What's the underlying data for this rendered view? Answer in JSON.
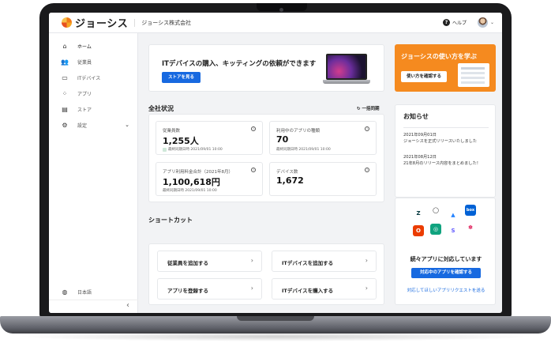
{
  "header": {
    "logo_text": "ジョーシス",
    "company": "ジョーシス株式会社",
    "help_label": "ヘルプ"
  },
  "sidebar": {
    "items": [
      {
        "label": "ホーム",
        "icon": "home-icon"
      },
      {
        "label": "従業員",
        "icon": "users-icon"
      },
      {
        "label": "ITデバイス",
        "icon": "laptop-icon"
      },
      {
        "label": "アプリ",
        "icon": "grid-icon"
      },
      {
        "label": "ストア",
        "icon": "store-icon"
      },
      {
        "label": "設定",
        "icon": "gear-icon"
      }
    ],
    "language": "日本語",
    "collapse_glyph": "‹"
  },
  "banner": {
    "title": "ITデバイスの購入、キッティングの依頼ができます",
    "button": "ストアを見る"
  },
  "promo": {
    "title": "ジョーシスの使い方を学ぶ",
    "button": "使い方を確認する"
  },
  "status": {
    "title": "全社状況",
    "sync_label": "一括同期",
    "stats": [
      {
        "label": "従業員数",
        "value": "1,255人",
        "note": "最終同期日時 2021/09/01 10:00"
      },
      {
        "label": "利用中のアプリの種類",
        "value": "70",
        "note": "最終同期日時 2021/09/01 10:00"
      },
      {
        "label": "アプリ利用料金合計（2021年8月）",
        "value": "1,100,618円",
        "note": "最終同期日時 2021/09/01 10:00"
      },
      {
        "label": "デバイス数",
        "value": "1,672",
        "note": ""
      }
    ]
  },
  "shortcuts": {
    "title": "ショートカット",
    "items": [
      "従業員を追加する",
      "ITデバイスを追加する",
      "アプリを登録する",
      "ITデバイスを購入する"
    ]
  },
  "news": {
    "title": "お知らせ",
    "items": [
      {
        "date": "2021年09月01日",
        "text": "ジョーシスを正式リリースいたしました"
      },
      {
        "date": "2021年08月12日",
        "text": "21年8月のリリース内容をまとめました！"
      }
    ]
  },
  "apps": {
    "title": "続々アプリに対応しています",
    "button": "対応中のアプリを確認する",
    "link": "対応してほしいアプリリクエストを送る",
    "logos": [
      {
        "glyph": "Z",
        "name": "zendesk-logo-icon",
        "color": "#03363d"
      },
      {
        "glyph": "◯",
        "name": "github-logo-icon",
        "color": "#111111"
      },
      {
        "glyph": "▲",
        "name": "atlassian-logo-icon",
        "color": "#2684ff"
      },
      {
        "glyph": "box",
        "name": "box-logo-icon",
        "color": "#0061d5"
      },
      {
        "glyph": "O",
        "name": "office-logo-icon",
        "color": "#eb3c00"
      },
      {
        "glyph": "◎",
        "name": "openai-logo-icon",
        "color": "#10a37f"
      },
      {
        "glyph": "S",
        "name": "stripe-logo-icon",
        "color": "#635bff"
      },
      {
        "glyph": "✽",
        "name": "slack-logo-icon",
        "color": "#e01e5a"
      }
    ]
  }
}
